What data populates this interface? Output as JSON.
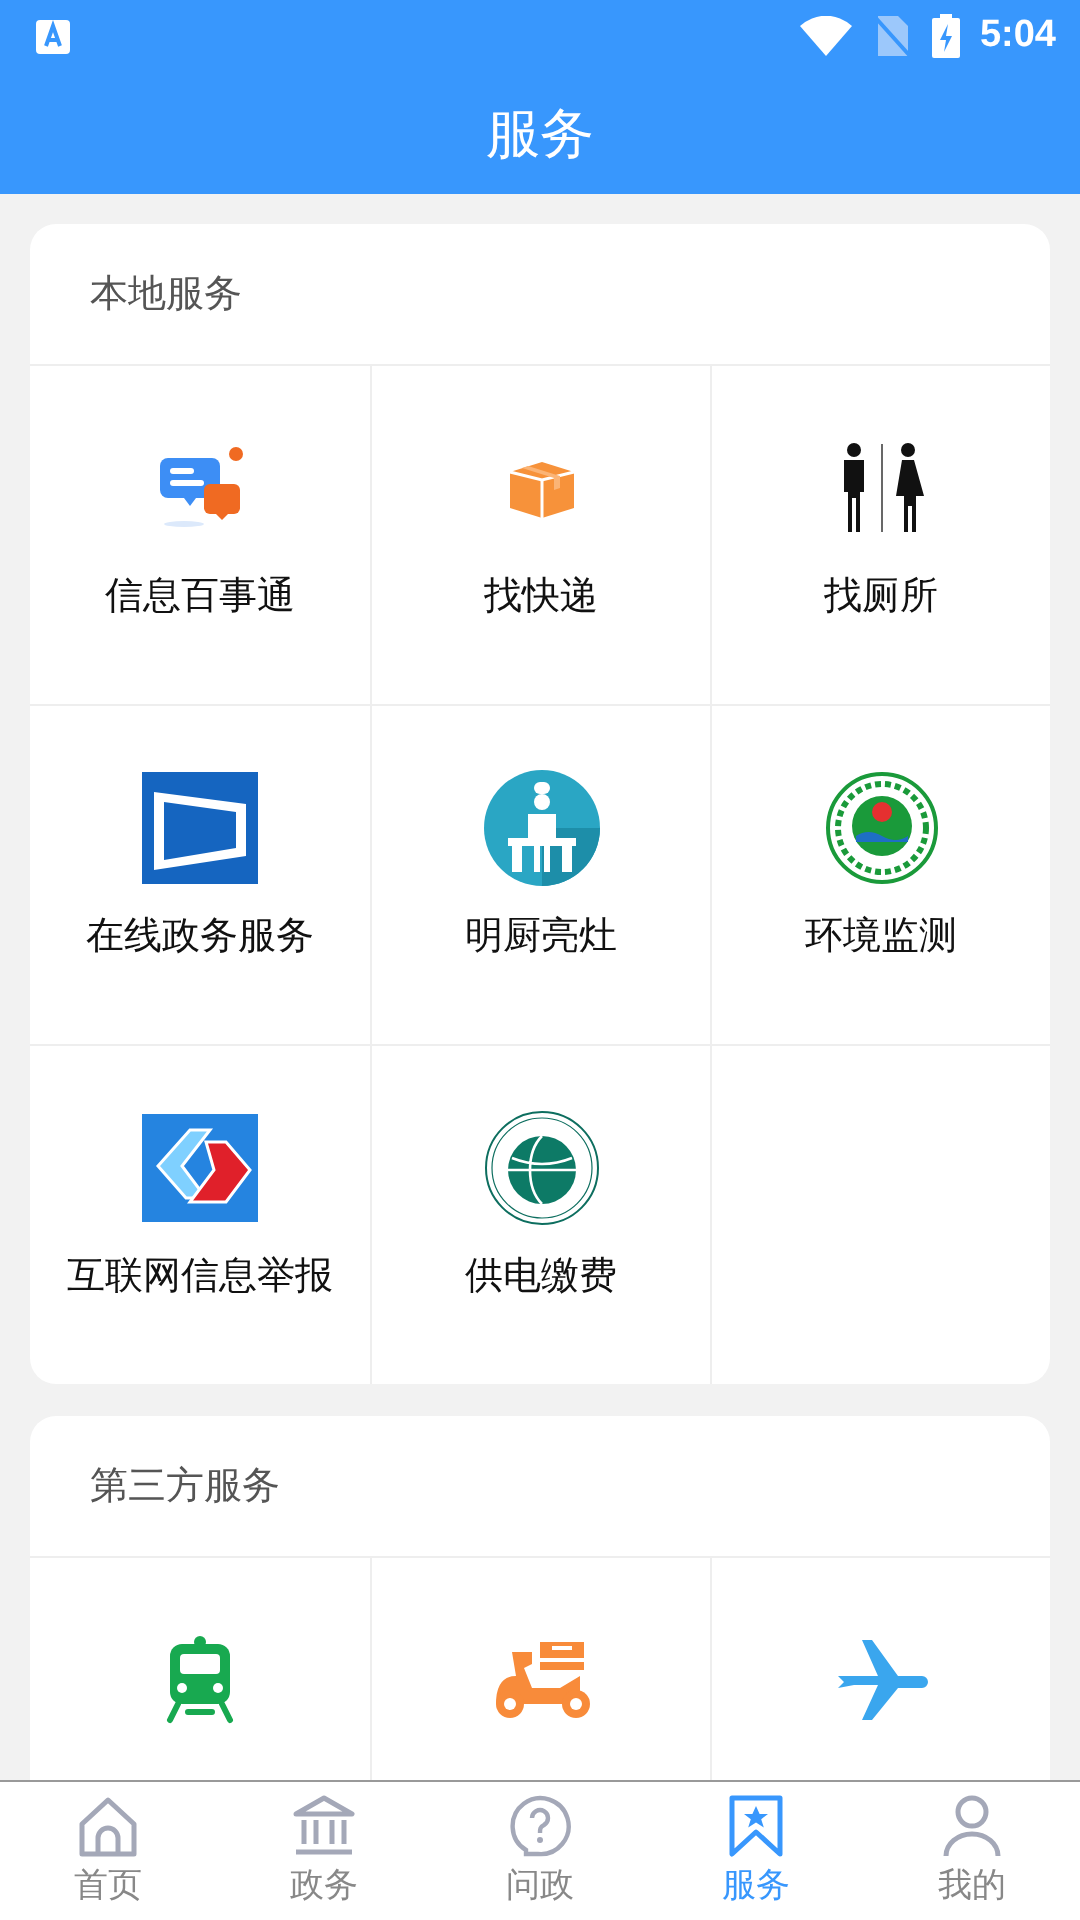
{
  "status_bar": {
    "time": "5:04"
  },
  "title": "服务",
  "sections": [
    {
      "title": "本地服务",
      "items": [
        {
          "label": "信息百事通",
          "kind": "chat"
        },
        {
          "label": "找快递",
          "kind": "box"
        },
        {
          "label": "找厕所",
          "kind": "toilet"
        },
        {
          "label": "在线政务服务",
          "kind": "gov"
        },
        {
          "label": "明厨亮灶",
          "kind": "chef"
        },
        {
          "label": "环境监测",
          "kind": "emblem"
        },
        {
          "label": "互联网信息举报",
          "kind": "report"
        },
        {
          "label": "供电缴费",
          "kind": "globe"
        }
      ]
    },
    {
      "title": "第三方服务",
      "items": [
        {
          "kind": "train"
        },
        {
          "kind": "scooter"
        },
        {
          "kind": "plane"
        }
      ]
    }
  ],
  "nav": [
    {
      "label": "首页",
      "kind": "home",
      "selected": false
    },
    {
      "label": "政务",
      "kind": "bank",
      "selected": false
    },
    {
      "label": "问政",
      "kind": "question",
      "selected": false
    },
    {
      "label": "服务",
      "kind": "bookmark",
      "selected": true
    },
    {
      "label": "我的",
      "kind": "person",
      "selected": false
    }
  ]
}
